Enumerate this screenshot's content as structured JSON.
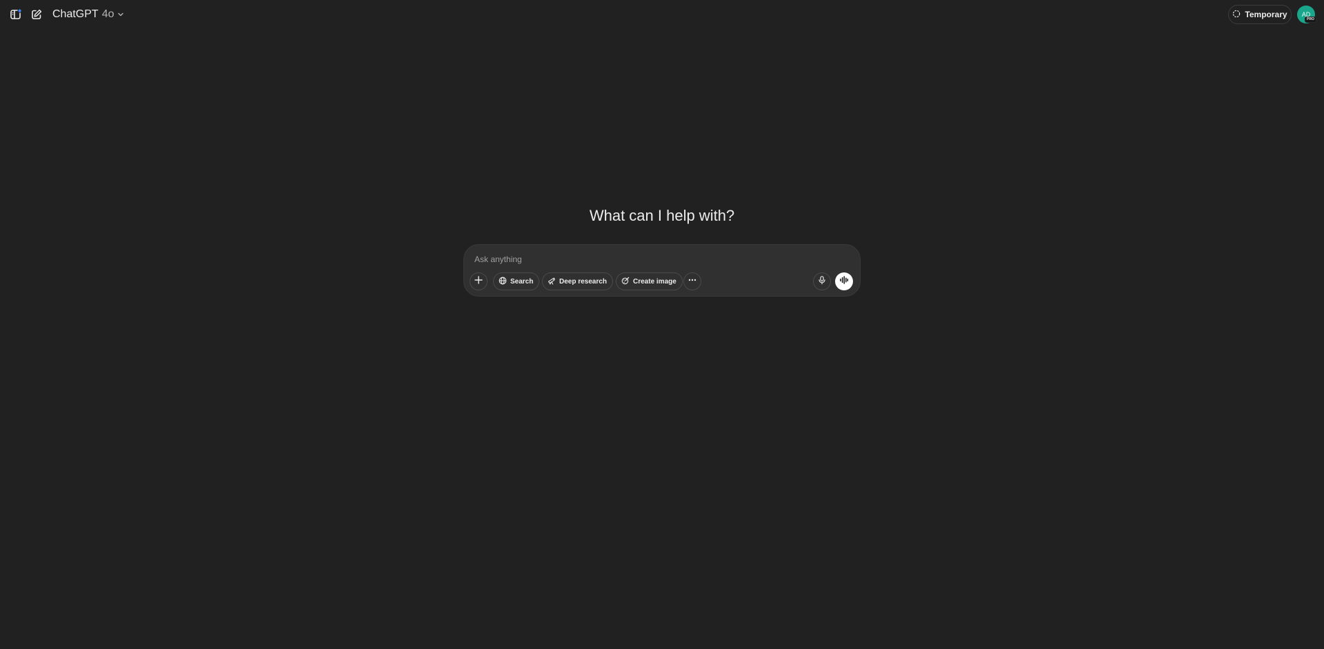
{
  "header": {
    "model_name": "ChatGPT",
    "model_version": "4o",
    "icons": {
      "sidebar": "sidebar-toggle-icon",
      "new_chat": "new-chat-icon",
      "chevron": "chevron-down-icon"
    },
    "temporary_label": "Temporary",
    "avatar_initials": "AD",
    "plan_badge": "PRO",
    "colors": {
      "background": "#212121",
      "avatar": "#19a68b",
      "notification_dot": "#3b82f6"
    }
  },
  "main": {
    "headline": "What can I help with?"
  },
  "composer": {
    "placeholder": "Ask anything",
    "value": "",
    "tools": [
      {
        "label": "Search",
        "icon": "globe-icon"
      },
      {
        "label": "Deep research",
        "icon": "telescope-icon"
      },
      {
        "label": "Create image",
        "icon": "image-brush-icon"
      }
    ],
    "icons": {
      "attach": "plus-icon",
      "more": "more-horizontal-icon",
      "dictate": "microphone-icon",
      "voice": "voice-waveform-icon"
    }
  }
}
